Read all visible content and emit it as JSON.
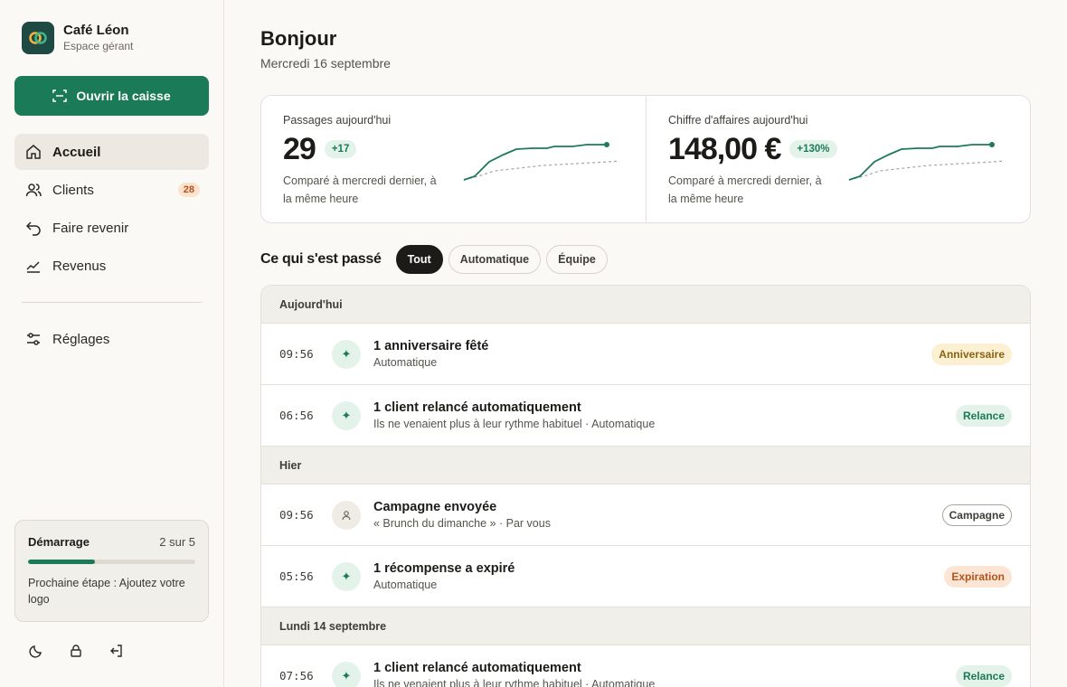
{
  "brand": {
    "name": "Café Léon",
    "subtitle": "Espace gérant"
  },
  "open_register": {
    "label": "Ouvrir la caisse"
  },
  "nav": [
    {
      "label": "Accueil",
      "icon": "home-icon",
      "active": true
    },
    {
      "label": "Clients",
      "icon": "users-icon",
      "badge": "28"
    },
    {
      "label": "Faire revenir",
      "icon": "return-arrow-icon"
    },
    {
      "label": "Revenus",
      "icon": "trend-chart-icon"
    }
  ],
  "settings": {
    "label": "Réglages",
    "icon": "sliders-icon"
  },
  "onboarding": {
    "title": "Démarrage",
    "count": "2 sur 5",
    "progress": 0.4,
    "next_step": "Prochaine étape : Ajoutez votre logo"
  },
  "footer_icons": [
    "moon-icon",
    "lock-icon",
    "logout-icon"
  ],
  "header": {
    "greeting": "Bonjour",
    "date": "Mercredi 16 septembre"
  },
  "stats": [
    {
      "label": "Passages aujourd'hui",
      "value": "29",
      "delta": "+17",
      "note": "Comparé à mercredi dernier, à la même heure"
    },
    {
      "label": "Chiffre d'affaires aujourd'hui",
      "value": "148,00 €",
      "delta": "+130%",
      "note": "Comparé à mercredi dernier, à la même heure"
    }
  ],
  "feed": {
    "title": "Ce qui s'est passé",
    "filters": [
      {
        "label": "Tout",
        "active": true
      },
      {
        "label": "Automatique",
        "active": false
      },
      {
        "label": "Équipe",
        "active": false
      }
    ],
    "groups": [
      {
        "label": "Aujourd'hui",
        "rows": [
          {
            "time": "09:56",
            "icon": "sparkle-icon",
            "title": "1 anniversaire fêté",
            "subtitle": "Automatique",
            "tag": "Anniversaire",
            "tag_style": "yellow"
          },
          {
            "time": "06:56",
            "icon": "sparkle-icon",
            "title": "1 client relancé automatiquement",
            "subtitle": "Ils ne venaient plus à leur rythme habituel · Automatique",
            "tag": "Relance",
            "tag_style": "green"
          }
        ]
      },
      {
        "label": "Hier",
        "rows": [
          {
            "time": "09:56",
            "icon": "person-icon",
            "title": "Campagne envoyée",
            "subtitle": "« Brunch du dimanche » · Par vous",
            "tag": "Campagne",
            "tag_style": "outline"
          },
          {
            "time": "05:56",
            "icon": "sparkle-icon",
            "title": "1 récompense a expiré",
            "subtitle": "Automatique",
            "tag": "Expiration",
            "tag_style": "orange"
          }
        ]
      },
      {
        "label": "Lundi 14 septembre",
        "rows": [
          {
            "time": "07:56",
            "icon": "sparkle-icon",
            "title": "1 client relancé automatiquement",
            "subtitle": "Ils ne venaient plus à leur rythme habituel · Automatique",
            "tag": "Relance",
            "tag_style": "green"
          }
        ]
      }
    ]
  },
  "colors": {
    "accent": "#1b7a57",
    "brand_tile": "#1e4a43",
    "badge_orange": "#b4531b"
  }
}
